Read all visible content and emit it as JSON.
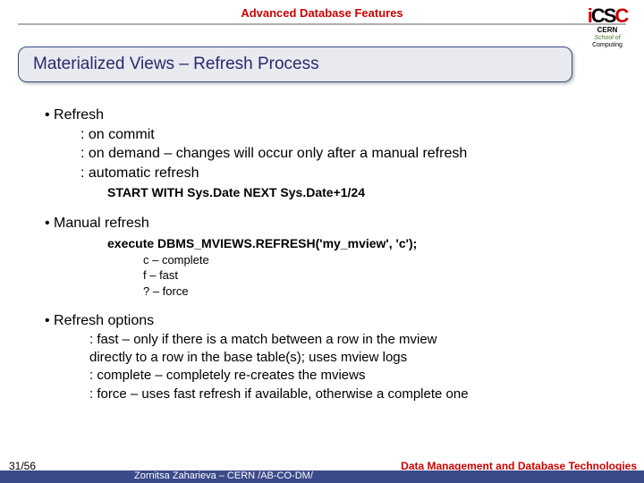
{
  "top_title": "Advanced Database Features",
  "logo": {
    "c1": "i",
    "c2": "C",
    "c3": "S",
    "c4": "C",
    "cern": "CERN",
    "sub1": "School",
    "sub2": "of",
    "sub3": "Computing"
  },
  "heading": "Materialized Views – Refresh Process",
  "b1": {
    "title": "Refresh",
    "l1": ": on commit",
    "l2": ": on demand – changes will occur only after a manual refresh",
    "l3": ": automatic refresh",
    "code": "START WITH Sys.Date NEXT Sys.Date+1/24"
  },
  "b2": {
    "title": "Manual refresh",
    "code": "execute DBMS_MVIEWS.REFRESH('my_mview', 'c');",
    "o1": "c – complete",
    "o2": "f – fast",
    "o3": "? – force"
  },
  "b3": {
    "title": "Refresh options",
    "l1a": ": fast –  only if there is a match between a row in the mview",
    "l1b": "directly to a row in the base table(s); uses mview logs",
    "l2": ": complete – completely re-creates the mviews",
    "l3": ": force – uses fast refresh if available, otherwise a complete one"
  },
  "footer": {
    "page": "31/56",
    "author": "Zornitsa Zaharieva – CERN /AB-CO-DM/",
    "right": "Data Management and Database Technologies"
  }
}
